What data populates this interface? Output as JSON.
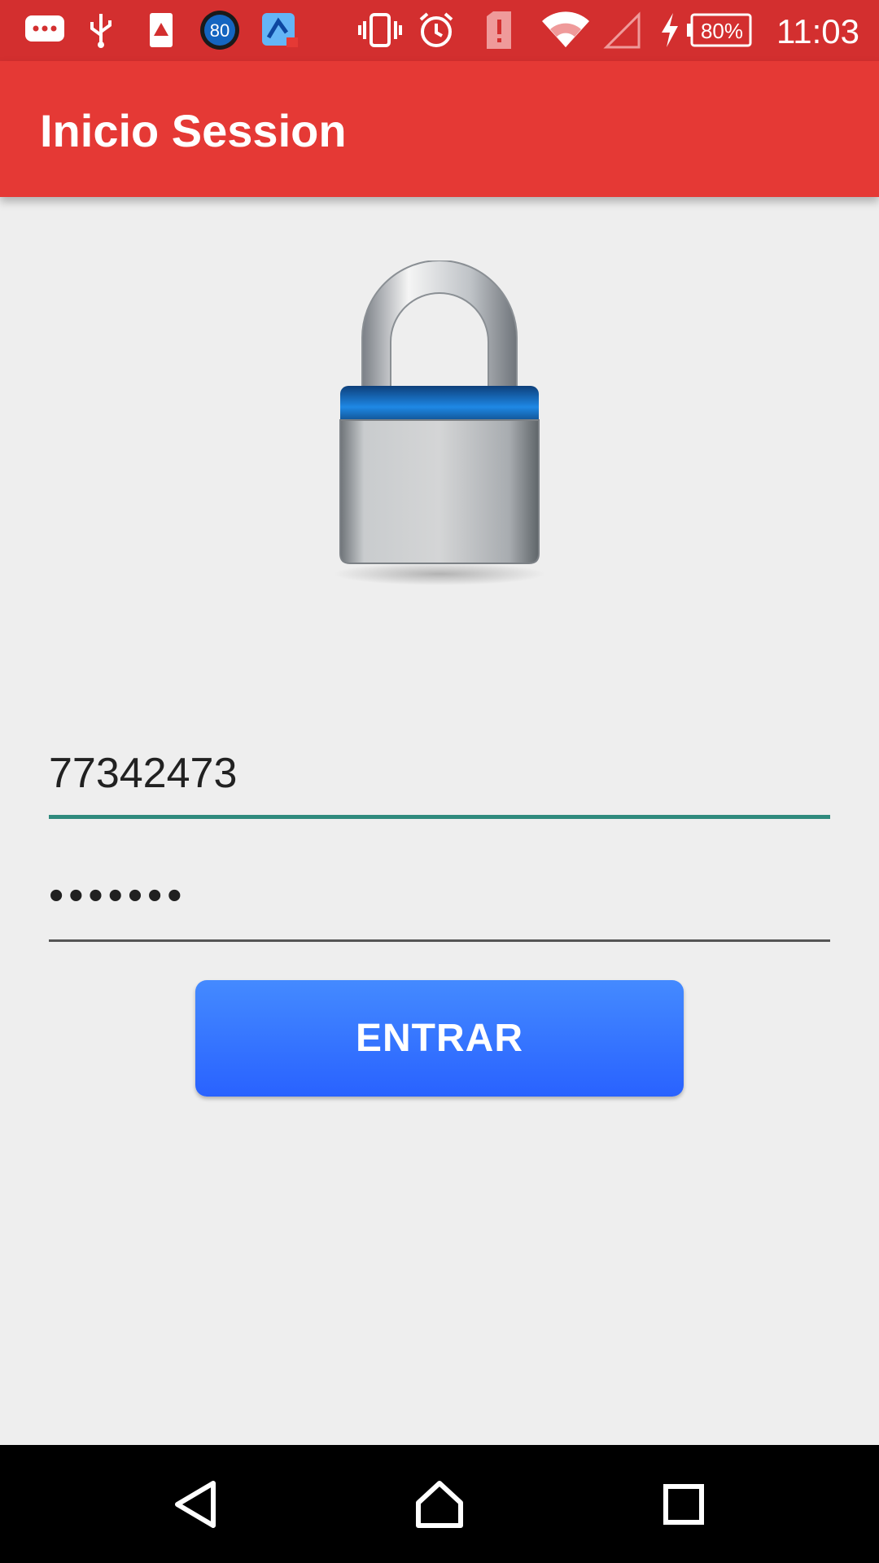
{
  "status_bar": {
    "time": "11:03",
    "battery_percent": "80%",
    "badge_number": "80",
    "icons": [
      "messages-icon",
      "usb-icon",
      "warning-icon",
      "speed-badge-icon",
      "app-notification-icon",
      "vibrate-icon",
      "alarm-icon",
      "sim-alert-icon",
      "wifi-icon",
      "signal-icon",
      "charging-icon",
      "battery-icon"
    ],
    "color": "#d32f2f"
  },
  "app_bar": {
    "title": "Inicio Session",
    "color": "#e53935"
  },
  "login": {
    "lock_icon": "padlock-icon",
    "username_value": "77342473",
    "password_value": "•••••••",
    "submit_label": "ENTRAR",
    "button_color": "#2979ff"
  },
  "nav_bar": {
    "buttons": [
      "back-icon",
      "home-icon",
      "recents-icon"
    ]
  }
}
